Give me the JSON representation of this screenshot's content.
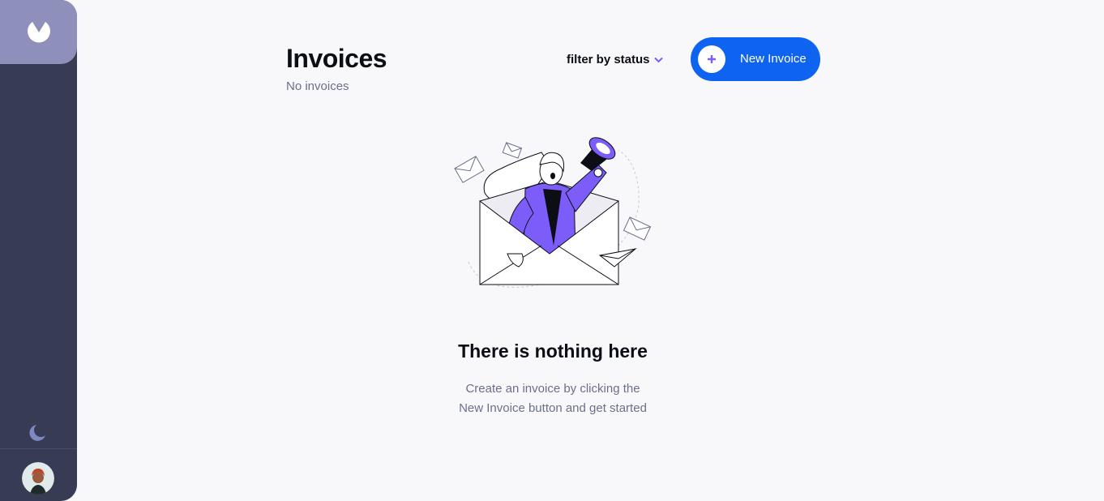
{
  "sidebar": {
    "logo_icon": "logo-icon",
    "theme_toggle_icon": "moon-icon",
    "avatar_icon": "user-avatar",
    "colors": {
      "background": "#373b53",
      "logo_box": "#8f8fbc"
    }
  },
  "header": {
    "title": "Invoices",
    "count_text": "No invoices",
    "filter_label": "filter by status",
    "new_button_label": "New Invoice"
  },
  "empty_state": {
    "title": "There is nothing here",
    "line1": "Create an invoice by clicking the",
    "line2": "New Invoice button and get started",
    "illustration": "woman-with-megaphone-in-envelope"
  },
  "colors": {
    "accent": "#7c5dfa",
    "button": "#0e63f0",
    "page_background": "#f8f8fb"
  }
}
